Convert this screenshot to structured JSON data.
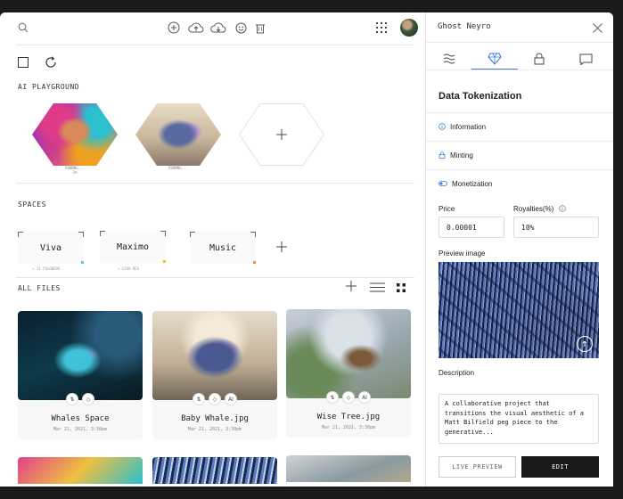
{
  "topbar": {
    "icons": [
      "search-icon",
      "add-circle-icon",
      "cloud-upload-icon",
      "cloud-download-icon",
      "emoji-icon",
      "trash-icon",
      "grid-menu-icon",
      "avatar"
    ]
  },
  "sections": {
    "ai_playground": "AI PLAYGROUND",
    "spaces": "SPACES",
    "all_files": "ALL FILES"
  },
  "playground": {
    "items": [
      {
        "caption_1": "RUNNNG...",
        "caption_2": "3%"
      },
      {
        "caption_1": "RUNNNG..."
      }
    ]
  },
  "spaces": [
    {
      "name": "Viva",
      "sub": "+ 31 FOLOWERS",
      "accent": "#4ec9f0"
    },
    {
      "name": "Maximo",
      "sub": "+ £349 REV",
      "accent": "#f0c419"
    },
    {
      "name": "Music",
      "sub": "",
      "accent": "#f08c3a"
    }
  ],
  "files": [
    {
      "name": "Whales Space",
      "date": "Mar 21, 2021, 3:30pm",
      "badges": [
        "⇅",
        "◇"
      ]
    },
    {
      "name": "Baby Whale.jpg",
      "date": "Mar 21, 2021, 3:30pm",
      "badges": [
        "⇅",
        "◇",
        "AI"
      ]
    },
    {
      "name": "Wise Tree.jpg",
      "date": "Mar 21, 2021, 3:30pm",
      "badges": [
        "⇅",
        "◇",
        "AI"
      ]
    }
  ],
  "panel": {
    "user": "Ghost Neyro",
    "title": "Data Tokenization",
    "rows": {
      "information": "Information",
      "minting": "Minting",
      "monetization": "Monetization"
    },
    "price_label": "Price",
    "price_value": "0.00001",
    "royalties_label": "Royalties(%)",
    "royalties_value": "10%",
    "preview_label": "Preview image",
    "description_label": "Description",
    "description_text": "A collaborative project that transitions the visual aesthetic of a Matt Bilfield peg piece to the generative...",
    "live_preview": "LIVE PREVIEW",
    "edit": "EDIT",
    "accent": "#3a7bd5"
  }
}
